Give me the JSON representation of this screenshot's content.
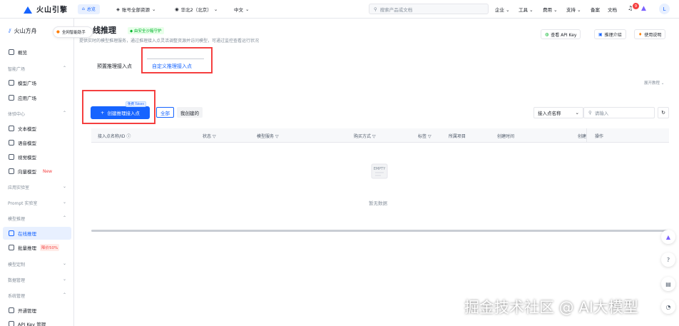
{
  "topbar": {
    "brand": "火山引擎",
    "home": "总览",
    "account": "账号全部资源",
    "region": "华北2（北京）",
    "language": "中文",
    "search_placeholder": "搜索产品或文档",
    "nav": [
      "企业",
      "工具",
      "费用",
      "支持",
      "备案",
      "文档"
    ],
    "notif_count": "9",
    "avatar": "L"
  },
  "sidebar": {
    "brand": "火山方舟",
    "assistant": "全网智能助手",
    "overview": "概览",
    "groups": [
      {
        "label": "智能广场",
        "items": [
          "模型广场",
          "应用广场"
        ]
      },
      {
        "label": "体验中心",
        "items": [
          "文本模型",
          "语音模型",
          "视觉模型",
          "向量模型"
        ]
      },
      {
        "label": "应用实验室",
        "items": []
      },
      {
        "label": "Prompt 实验室",
        "items": []
      },
      {
        "label": "模型推理",
        "items": [
          "在线推理",
          "批量推理"
        ]
      },
      {
        "label": "模型定制",
        "items": []
      },
      {
        "label": "数据管理",
        "items": []
      },
      {
        "label": "系统管理",
        "items": [
          "开通管理",
          "API Key 管理"
        ]
      }
    ],
    "new_badge": "New",
    "discount_badge": "降价50%"
  },
  "page": {
    "title": "在线推理",
    "title_visible": "线推理",
    "safe_badge": "由安全沙箱守护",
    "subtitle": "提供实时的模型推理服务，通过推理接入点灵活调整资源并访问模型，可通过监控查看运行状况",
    "header_buttons": [
      "查看 API Key",
      "推理介绍",
      "使用说明"
    ],
    "tabs": [
      "预置推理接入点",
      "自定义推理接入点"
    ],
    "expand_link": "展开教程",
    "create_button": "创建推理接入点",
    "free_token": "免费 Token",
    "filter_all": "全部",
    "filter_mine": "我创建的",
    "filter_select": "接入点名称",
    "filter_input_placeholder": "请输入",
    "columns": [
      "接入点名称/ID",
      "状态",
      "模型服务",
      "购买方式",
      "标签",
      "所属项目",
      "创建时间",
      "创建",
      "操作"
    ],
    "empty_img_label": "EMPTY",
    "empty_text": "暂无数据"
  },
  "watermark": "掘金技术社区 @ AI大模型"
}
